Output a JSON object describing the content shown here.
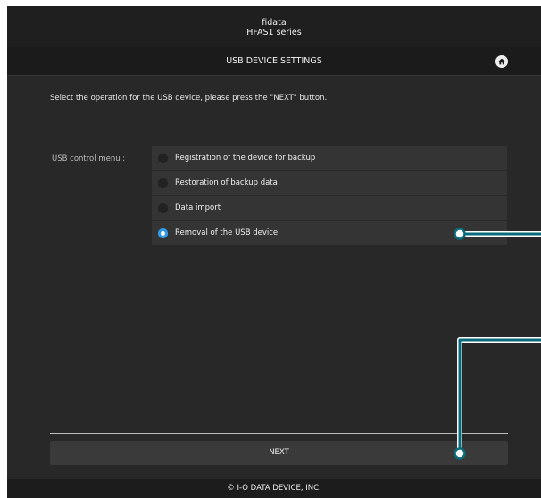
{
  "header": {
    "brand": "fidata",
    "series": "HFAS1 series",
    "title": "USB DEVICE SETTINGS",
    "home_icon": "home-icon"
  },
  "main": {
    "instruction": "Select the operation for the USB device, please press the \"NEXT\" button.",
    "menu_label": "USB control menu :",
    "options": [
      {
        "label": "Registration of the device for backup",
        "selected": false
      },
      {
        "label": "Restoration of backup data",
        "selected": false
      },
      {
        "label": "Data import",
        "selected": false
      },
      {
        "label": "Removal of the USB device",
        "selected": true
      }
    ],
    "next_label": "NEXT"
  },
  "footer": {
    "copyright": "© I-O DATA DEVICE, INC."
  },
  "colors": {
    "background": "#282828",
    "accent": "#2e9ae6",
    "callout": "#0b6b7a"
  }
}
